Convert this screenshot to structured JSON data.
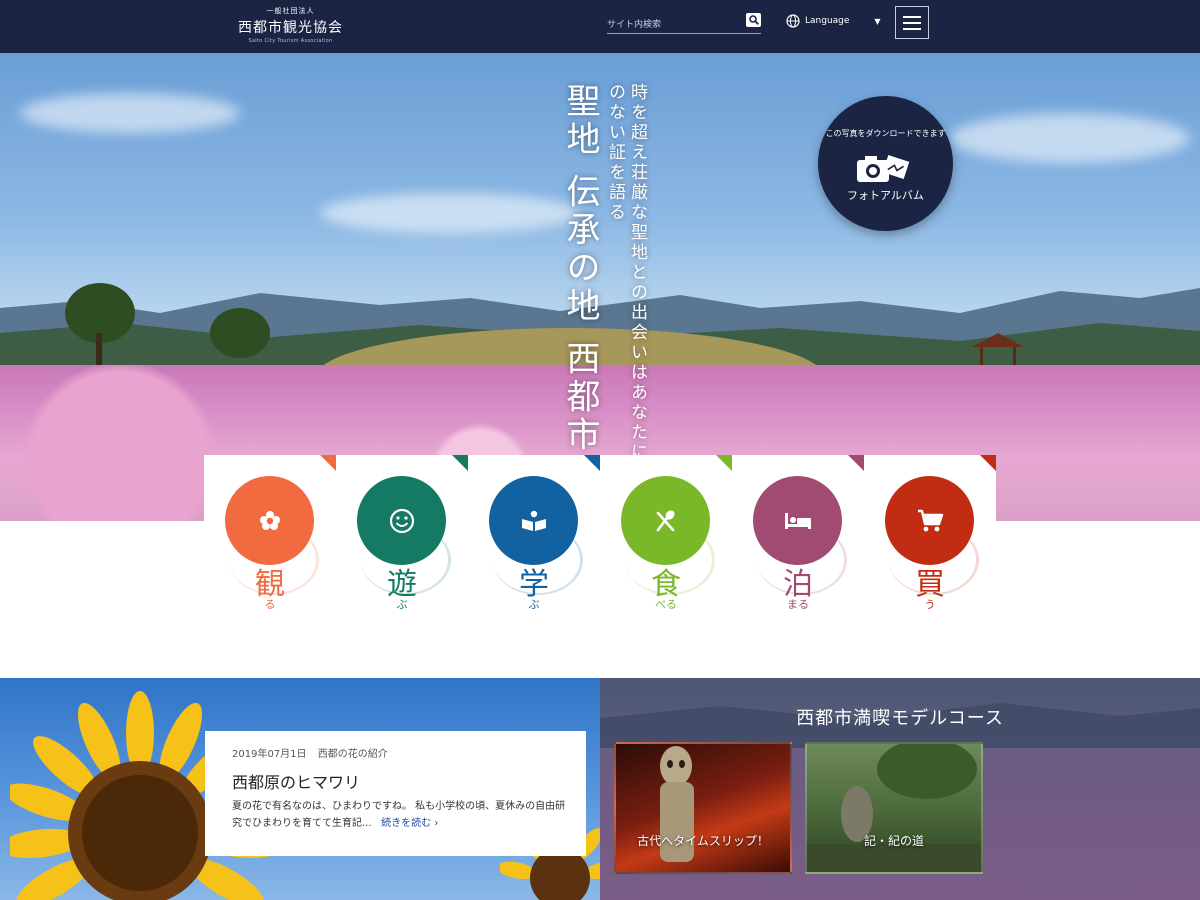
{
  "header": {
    "logo_small": "一般社団法人",
    "logo_main": "西都市観光協会",
    "logo_en": "Saito City Tourism Association",
    "search_placeholder": "サイト内検索",
    "language_label": "Language",
    "menu_icon": "hamburger-icon",
    "search_icon": "magnifier-icon",
    "language_icon": "globe-icon"
  },
  "hero": {
    "catch_big": "聖地 伝承の地 西都市",
    "catch_small": "時を超え荘厳な聖地との出会いはあなたに比類のない証を語る",
    "photo_album": {
      "caption": "この写真をダウンロードできます",
      "label": "フォトアルバム",
      "icon": "camera-icon"
    }
  },
  "categories": [
    {
      "kanji": "観",
      "kana": "る",
      "color": "#f26a3f",
      "icon": "flower-icon"
    },
    {
      "kanji": "遊",
      "kana": "ぶ",
      "color": "#157a63",
      "icon": "smile-icon"
    },
    {
      "kanji": "学",
      "kana": "ぶ",
      "color": "#1261a0",
      "icon": "book-icon"
    },
    {
      "kanji": "食",
      "kana": "べる",
      "color": "#7ab729",
      "icon": "fork-spoon-icon"
    },
    {
      "kanji": "泊",
      "kana": "まる",
      "color": "#a14a72",
      "icon": "bed-icon"
    },
    {
      "kanji": "買",
      "kana": "う",
      "color": "#c22c12",
      "icon": "cart-icon"
    }
  ],
  "news": {
    "date": "2019年07月1日",
    "category": "西都の花の紹介",
    "title": "西都原のヒマワリ",
    "body": "夏の花で有名なのは、ひまわりですね。 私も小学校の頃、夏休みの自由研究でひまわりを育てて生育記...",
    "more": "続きを読む"
  },
  "course": {
    "title": "西都市満喫モデルコース",
    "cards": [
      {
        "label": "古代へタイムスリップ！"
      },
      {
        "label": "記・紀の道"
      }
    ]
  }
}
